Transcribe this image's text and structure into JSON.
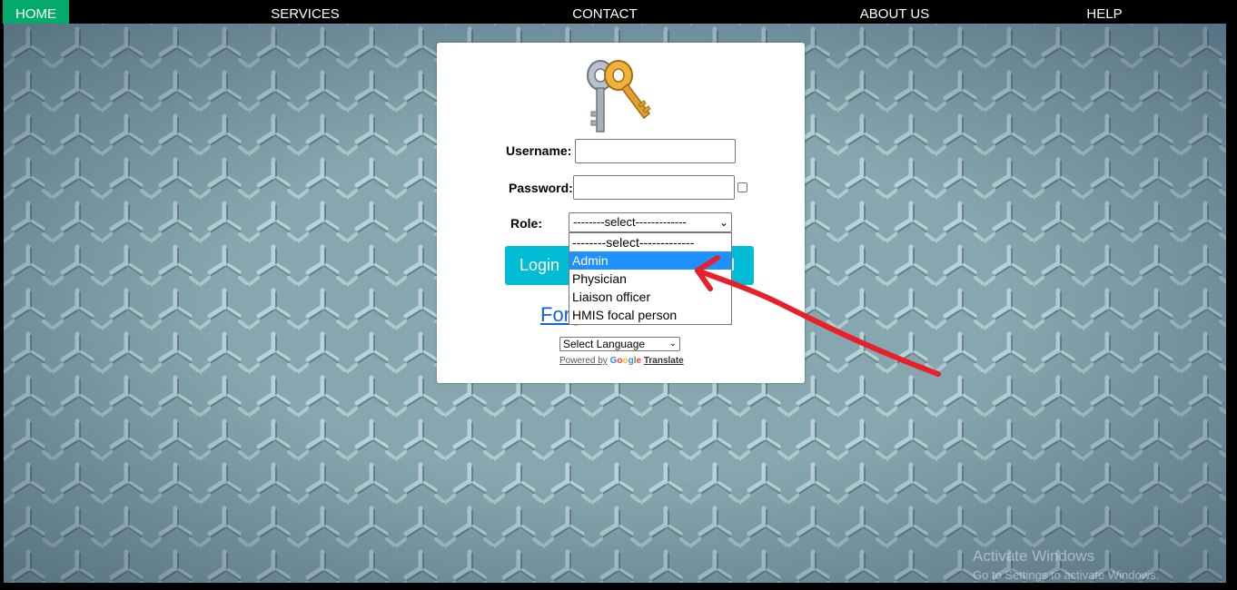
{
  "nav": {
    "items": [
      {
        "label": "HOME",
        "active": true
      },
      {
        "label": "SERVICES",
        "active": false
      },
      {
        "label": "CONTACT",
        "active": false
      },
      {
        "label": "ABOUT US",
        "active": false
      },
      {
        "label": "HELP",
        "active": false
      }
    ],
    "active_color": "#04AA6D"
  },
  "login": {
    "username_label": "Username:",
    "username_value": "",
    "password_label": "Password:",
    "password_value": "",
    "role_label": "Role:",
    "role_selected": "--------select-------------",
    "login_button": "Login",
    "cancel_button_suffix": "el",
    "forgot_link_prefix": "Forg",
    "icon": "keys-icon",
    "button_color": "#00bcd4"
  },
  "role_dropdown": {
    "options": [
      "--------select-------------",
      "Admin",
      "Physician",
      "Liaison officer",
      "HMIS focal person"
    ],
    "highlighted": "Admin",
    "highlight_color": "#1e90ff"
  },
  "translate": {
    "select_label": "Select Language",
    "powered_by": "Powered by",
    "google": "Google",
    "translate_link": "Translate"
  },
  "watermark": {
    "title": "Activate Windows",
    "subtitle": "Go to Settings to activate Windows."
  },
  "annotation": {
    "arrow_color": "#e8202a"
  }
}
